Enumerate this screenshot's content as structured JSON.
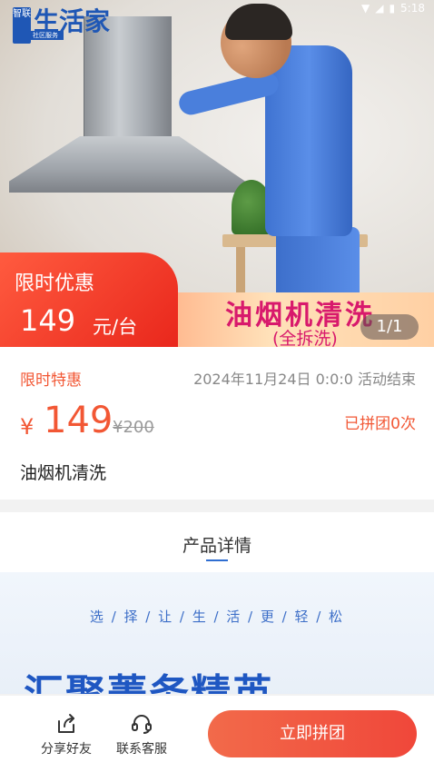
{
  "status_bar": {
    "time": "5:18"
  },
  "hero": {
    "logo_mark": "智联",
    "logo_text": "生活家",
    "logo_sub": "社区服务",
    "promo_label": "限时优惠",
    "promo_price": "149",
    "promo_unit": "元/台",
    "banner_title": "油烟机清洗",
    "banner_subtitle": "(全拆洗)",
    "image_indicator": "1/1"
  },
  "info": {
    "tag": "限时特惠",
    "end_time": "2024年11月24日 0:0:0 活动结束",
    "currency_symbol": "¥",
    "price": "149",
    "original_price": "¥200",
    "group_count": "已拼团0次",
    "product_name": "油烟机清洗"
  },
  "detail": {
    "title": "产品详情",
    "slogan": "选 / 择 / 让 / 生 / 活 / 更 / 轻 / 松",
    "heading": "汇聚菁务精英"
  },
  "bottom_bar": {
    "share_label": "分享好友",
    "service_label": "联系客服",
    "cta_label": "立即拼团"
  }
}
